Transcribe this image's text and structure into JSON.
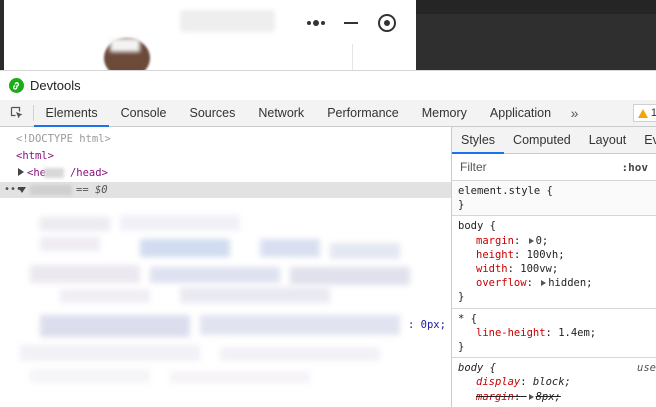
{
  "window": {
    "title": "Devtools"
  },
  "tabs": [
    {
      "label": "Elements",
      "active": true
    },
    {
      "label": "Console",
      "active": false
    },
    {
      "label": "Sources",
      "active": false
    },
    {
      "label": "Network",
      "active": false
    },
    {
      "label": "Performance",
      "active": false
    },
    {
      "label": "Memory",
      "active": false
    },
    {
      "label": "Application",
      "active": false
    }
  ],
  "more_tabs_glyph": "»",
  "warning_count": "1",
  "elements": {
    "doctype": "<!DOCTYPE html>",
    "html_open": "<html>",
    "head_prefix": "<he",
    "head_suffix": "/head>",
    "selected_suffix": "== $0",
    "selected_dots": "•••",
    "truncated_value": ": 0px;"
  },
  "styles_panel": {
    "tabs": [
      {
        "label": "Styles",
        "active": true
      },
      {
        "label": "Computed",
        "active": false
      },
      {
        "label": "Layout",
        "active": false
      },
      {
        "label": "Ev",
        "active": false
      }
    ],
    "filter_placeholder": "Filter",
    "hov_label": ":hov",
    "element_style_open": "element.style {",
    "element_style_close": "}",
    "rules": [
      {
        "selector": "body {",
        "declarations": [
          {
            "prop": "margin",
            "colon": ":",
            "has_arrow": true,
            "value": "0;"
          },
          {
            "prop": "height",
            "colon": ":",
            "has_arrow": false,
            "value": "100vh;"
          },
          {
            "prop": "width",
            "colon": ":",
            "has_arrow": false,
            "value": "100vw;"
          },
          {
            "prop": "overflow",
            "colon": ":",
            "has_arrow": true,
            "value": "hidden;"
          }
        ],
        "close": "}"
      },
      {
        "selector": "* {",
        "declarations": [
          {
            "prop": "line-height",
            "colon": ":",
            "has_arrow": false,
            "value": "1.4em;"
          }
        ],
        "close": "}"
      }
    ],
    "ua_rule": {
      "selector": "body {",
      "source": "use",
      "declarations": [
        {
          "prop": "display",
          "colon": ":",
          "value": "block;",
          "struck": false
        },
        {
          "prop": "margin",
          "colon": ":",
          "value": "8px;",
          "struck": true
        }
      ]
    }
  },
  "colors": {
    "accent": "#1a73e8",
    "logo": "#1aad19",
    "css_property": "#c80000",
    "tag": "#881280"
  }
}
